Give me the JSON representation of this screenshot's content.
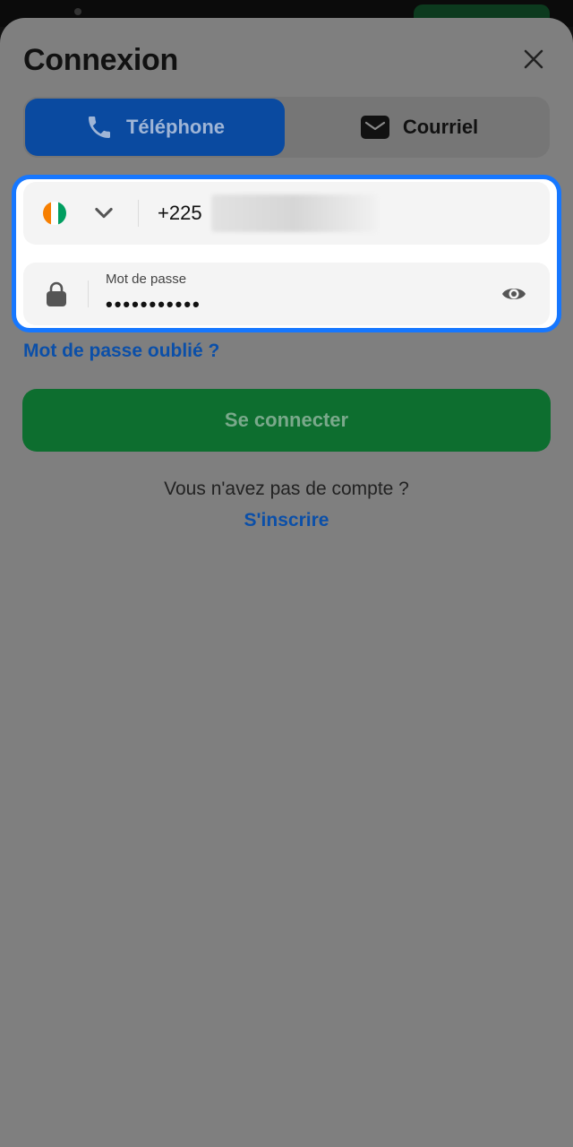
{
  "header": {
    "title": "Connexion"
  },
  "tabs": [
    {
      "label": "Téléphone",
      "icon": "phone-icon",
      "active": true
    },
    {
      "label": "Courriel",
      "icon": "mail-icon",
      "active": false
    }
  ],
  "phone_field": {
    "country_flag": "cote-divoire-flag",
    "flag_colors": [
      "#f77f00",
      "#ffffff",
      "#009e60"
    ],
    "dial_code": "+225",
    "value": ""
  },
  "password_field": {
    "label": "Mot de passe",
    "value_masked": "•••••••••••"
  },
  "links": {
    "forgot_password": "Mot de passe oublié ?",
    "no_account": "Vous n'avez pas de compte ?",
    "signup": "S'inscrire"
  },
  "buttons": {
    "login": "Se connecter"
  },
  "colors": {
    "primary_blue": "#1677ff",
    "link_blue": "#0b4fa8",
    "login_green": "#0d6e2f"
  }
}
